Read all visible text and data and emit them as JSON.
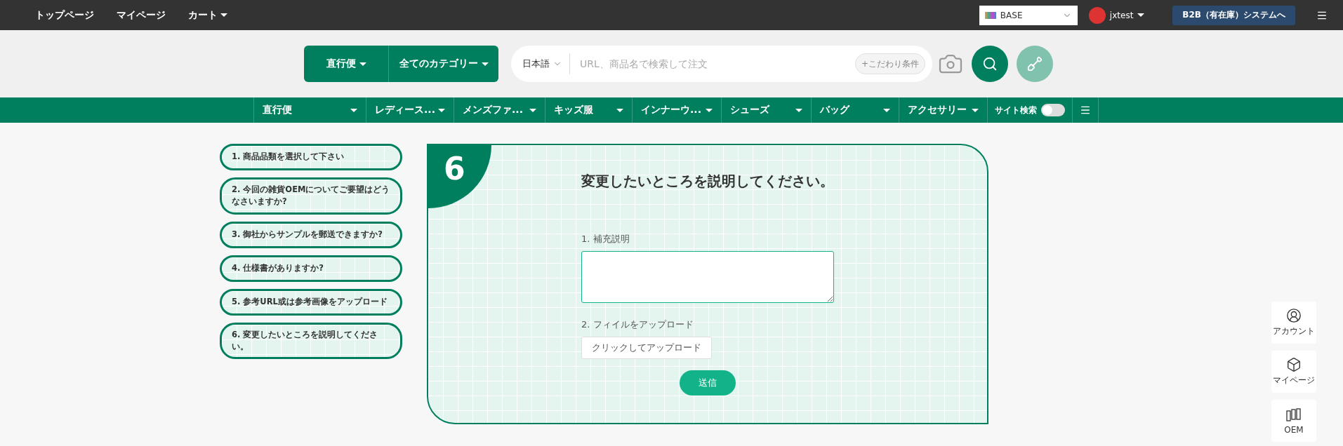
{
  "top_nav": {
    "links": [
      {
        "label": "トップページ",
        "dropdown": false
      },
      {
        "label": "マイページ",
        "dropdown": false
      },
      {
        "label": "カート",
        "dropdown": true
      }
    ],
    "store_select": {
      "value": "BASE"
    },
    "user": {
      "name": "jxtest"
    },
    "b2b_button": "B2B（有在庫）システムへ"
  },
  "search": {
    "mode": "直行便",
    "category": "全てのカテゴリー",
    "language": "日本語",
    "placeholder": "URL、商品名で検索して注文",
    "filter_button": "+こだわり条件"
  },
  "categories": [
    {
      "label": "直行便"
    },
    {
      "label": "レディース..."
    },
    {
      "label": "メンズファ..."
    },
    {
      "label": "キッズ服"
    },
    {
      "label": "インナーウ..."
    },
    {
      "label": "シューズ"
    },
    {
      "label": "バッグ"
    },
    {
      "label": "アクセサリー"
    }
  ],
  "site_search": {
    "label": "サイト検索",
    "on": false
  },
  "steps": [
    {
      "label": "1. 商品品類を選択して下さい"
    },
    {
      "label": "2. 今回の雑貨OEMについてご要望はどうなさいますか?"
    },
    {
      "label": "3. 御社からサンプルを郵送できますか?"
    },
    {
      "label": "4. 仕様書がありますか?"
    },
    {
      "label": "5. 参考URL或は参考画像をアップロード"
    },
    {
      "label": "6. 変更したいところを説明してください。"
    }
  ],
  "card": {
    "number": "6",
    "title": "変更したいところを説明してください。",
    "fields": [
      {
        "kind": "textarea",
        "label": "1. 補充説明"
      },
      {
        "kind": "upload",
        "label": "2. フィイルをアップロード",
        "button": "クリックしてアップロード"
      }
    ],
    "submit": "送信"
  },
  "side_buttons": [
    {
      "kind": "account",
      "label": "アカウント"
    },
    {
      "kind": "mypage",
      "label": "マイページ"
    },
    {
      "kind": "oem",
      "label": "OEM"
    }
  ]
}
